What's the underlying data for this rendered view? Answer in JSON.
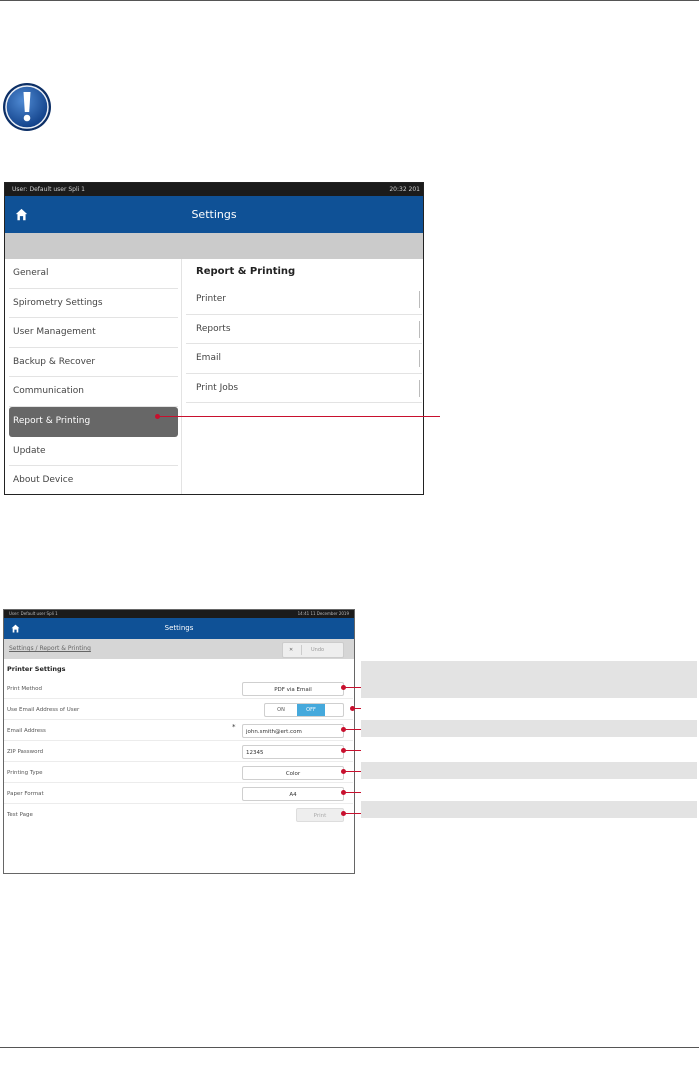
{
  "screen1": {
    "status_user": "User: Default user Spli 1",
    "status_time": "20:32 201",
    "header_title": "Settings",
    "sidebar_items": [
      "General",
      "Spirometry Settings",
      "User Management",
      "Backup & Recover",
      "Communication",
      "Report & Printing",
      "Update",
      "About Device"
    ],
    "active_item": "Report & Printing",
    "main_title": "Report & Printing",
    "main_options": [
      "Printer",
      "Reports",
      "Email",
      "Print Jobs"
    ]
  },
  "screen2": {
    "status_user": "User: Default user Spli 1",
    "status_time": "14:41 11 December 2019",
    "header_title": "Settings",
    "breadcrumb": "Settings / Report & Printing",
    "close_label": "✕",
    "undo_label": "Undo",
    "section_title": "Printer Settings",
    "rows": {
      "print_method": {
        "label": "Print Method",
        "value": "PDF via Email"
      },
      "use_email": {
        "label": "Use Email Address of User",
        "on_label": "ON",
        "off_label": "OFF",
        "selected": "OFF"
      },
      "email_address": {
        "label": "Email Address",
        "value": "john.smith@ert.com"
      },
      "zip_password": {
        "label": "ZIP Password",
        "value": "12345"
      },
      "printing_type": {
        "label": "Printing Type",
        "value": "Color"
      },
      "paper_format": {
        "label": "Paper Format",
        "value": "A4"
      },
      "test_page": {
        "label": "Test Page",
        "button": "Print"
      }
    }
  },
  "colors": {
    "header_blue": "#0f5196",
    "toggle_blue": "#45a9dc",
    "callout_red": "#c8102e",
    "active_grey": "#676767"
  },
  "icons": [
    "notice-exclamation-icon",
    "home-icon"
  ]
}
